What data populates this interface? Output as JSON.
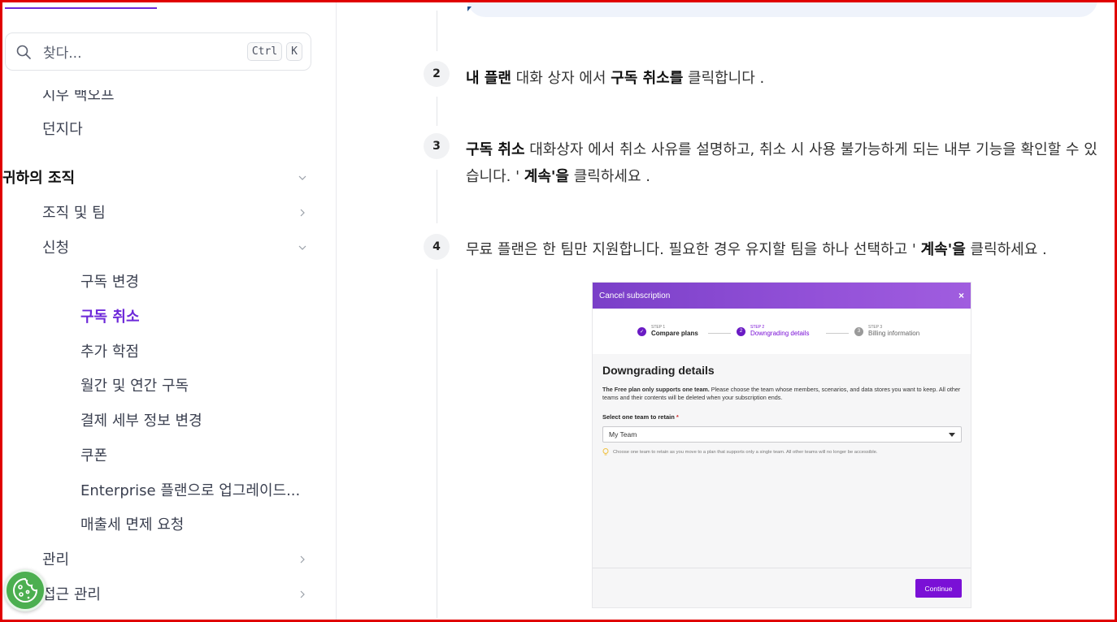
{
  "search": {
    "placeholder": "찾다...",
    "kbd1": "Ctrl",
    "kbd2": "K"
  },
  "sidebar": {
    "items": [
      {
        "label": "시우 백오프"
      },
      {
        "label": "던지다"
      },
      {
        "label": "귀하의 조직"
      },
      {
        "label": "조직 및 팀"
      },
      {
        "label": "신청"
      },
      {
        "label": "구독 변경"
      },
      {
        "label": "구독 취소"
      },
      {
        "label": "추가 학점"
      },
      {
        "label": "월간 및 연간 구독"
      },
      {
        "label": "결제 세부 정보 변경"
      },
      {
        "label": "쿠폰"
      },
      {
        "label": "Enterprise 플랜으로 업그레이드..."
      },
      {
        "label": "매출세 면제 요청"
      },
      {
        "label": "관리"
      },
      {
        "label": "접근 관리"
      }
    ]
  },
  "steps": [
    {
      "num": "2",
      "b1": "내 플랜",
      "t1": " 대화 상자 에서 ",
      "b2": "구독 취소를",
      "t2": " 클릭합니다 ."
    },
    {
      "num": "3",
      "b1": "구독 취소",
      "t1": " 대화상자 에서 취소 사유를 설명하고, 취소 시 사용 불가능하게 되는 내부 기능을 확인할 수 있습니다. ' ",
      "b2": "계속'을",
      "t2": " 클릭하세요 ."
    },
    {
      "num": "4",
      "t0": "무료 플랜은 한 팀만 지원합니다. 필요한 경우 유지할 팀을 하나 선택하고 ' ",
      "b1": "계속'을",
      "t1": " 클릭하세요 ."
    }
  ],
  "screenshot": {
    "header": "Cancel subscription",
    "close": "×",
    "steps": [
      {
        "small": "STEP 1",
        "label": "Compare plans",
        "mark": "✓"
      },
      {
        "small": "STEP 2",
        "label": "Downgrading details",
        "mark": "2"
      },
      {
        "small": "STEP 3",
        "label": "Billing information",
        "mark": "3"
      }
    ],
    "title": "Downgrading details",
    "desc_bold": "The Free plan only supports one team.",
    "desc": " Please choose the team whose members, scenarios, and data stores you want to keep. All other teams and their contents will be deleted when your subscription ends.",
    "select_label": "Select one team to retain",
    "required_mark": "*",
    "select_value": "My Team",
    "hint": "Choose one team to retain as you move to a plan that supports only a single team. All other teams will no longer be accessible.",
    "button": "Continue"
  },
  "icons": {
    "search": "search-icon",
    "chevron_down": "chevron-down-icon",
    "chevron_right": "chevron-right-icon",
    "cookie": "cookie-icon",
    "lightbulb": "lightbulb-icon"
  },
  "colors": {
    "accent": "#6d28d9",
    "frame": "#e00000",
    "cookie": "#4caf50",
    "screenshot_button": "#7a10d6"
  }
}
